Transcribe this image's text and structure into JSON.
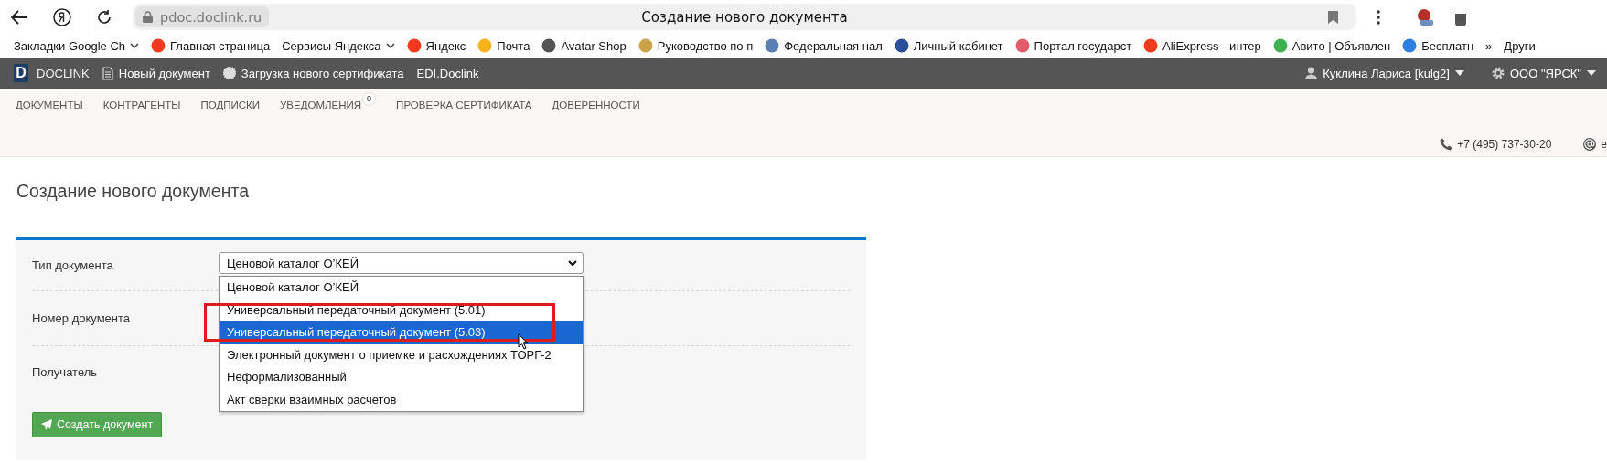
{
  "browser": {
    "url": "pdoc.doclink.ru",
    "tab_title": "Создание нового документа",
    "bookmarks": [
      {
        "label": "Закладки Google Ch",
        "kind": "folder"
      },
      {
        "label": "Главная страница",
        "kind": "link",
        "color": "#f33a1f"
      },
      {
        "label": "Сервисы Яндекса",
        "kind": "folder"
      },
      {
        "label": "Яндекс",
        "kind": "link",
        "color": "#f33a1f"
      },
      {
        "label": "Почта",
        "kind": "link",
        "color": "#f5b21b"
      },
      {
        "label": "Avatar Shop",
        "kind": "link",
        "color": "#555555"
      },
      {
        "label": "Руководство по п",
        "kind": "link",
        "color": "#c9a24a"
      },
      {
        "label": "Федеральная нал",
        "kind": "link",
        "color": "#5a7fb5"
      },
      {
        "label": "Личный кабинет",
        "kind": "link",
        "color": "#2a4f9a"
      },
      {
        "label": "Портал государст",
        "kind": "link",
        "color": "#e05b6b"
      },
      {
        "label": "AliExpress - интер",
        "kind": "link",
        "color": "#ee3b1b"
      },
      {
        "label": "Авито | Объявлен",
        "kind": "link",
        "color": "#3fb04f"
      },
      {
        "label": "Бесплатн",
        "kind": "link",
        "color": "#2f7fe0"
      },
      {
        "label": "»",
        "kind": "more"
      },
      {
        "label": "Други",
        "kind": "folder-plain"
      }
    ]
  },
  "app_bar": {
    "logo_letter": "D",
    "logo_text": "DOCLINK",
    "links": [
      {
        "label": "Новый документ",
        "kind": "document"
      },
      {
        "label": "Загрузка нового сертификата",
        "kind": "certificate"
      },
      {
        "label": "EDI.Doclink",
        "kind": "plain"
      }
    ],
    "user": "Куклина Лариса [kulg2]",
    "organization": "ООО \"ЯРСК\""
  },
  "nav": [
    {
      "label": "ДОКУМЕНТЫ"
    },
    {
      "label": "КОНТРАГЕНТЫ"
    },
    {
      "label": "ПОДПИСКИ"
    },
    {
      "label": "УВЕДОМЛЕНИЯ",
      "badge": "0"
    },
    {
      "label": "ПРОВЕРКА СЕРТИФИКАТА"
    },
    {
      "label": "ДОВЕРЕННОСТИ"
    }
  ],
  "contacts": {
    "phone": "+7 (495) 737-30-20",
    "email": "e"
  },
  "page_title": "Создание нового документа",
  "form": {
    "fields": [
      {
        "label": "Тип документа",
        "kind": "select",
        "value": "Ценовой каталог О’КЕЙ",
        "expanded": true,
        "options": [
          {
            "label": "Ценовой каталог О’КЕЙ",
            "highlighted": false
          },
          {
            "label": "Универсальный передаточный документ (5.01)",
            "highlighted": false
          },
          {
            "label": "Универсальный передаточный документ (5.03)",
            "highlighted": true
          },
          {
            "label": "Электронный документ о приемке и расхождениях ТОРГ-2",
            "highlighted": false
          },
          {
            "label": "Неформализованный",
            "highlighted": false
          },
          {
            "label": "Акт сверки взаимных расчетов",
            "highlighted": false
          }
        ]
      },
      {
        "label": "Номер документа",
        "kind": "hidden"
      },
      {
        "label": "Получатель",
        "kind": "hidden"
      }
    ],
    "submit": "Создать документ"
  },
  "highlight": {
    "kind": "rectangle"
  }
}
